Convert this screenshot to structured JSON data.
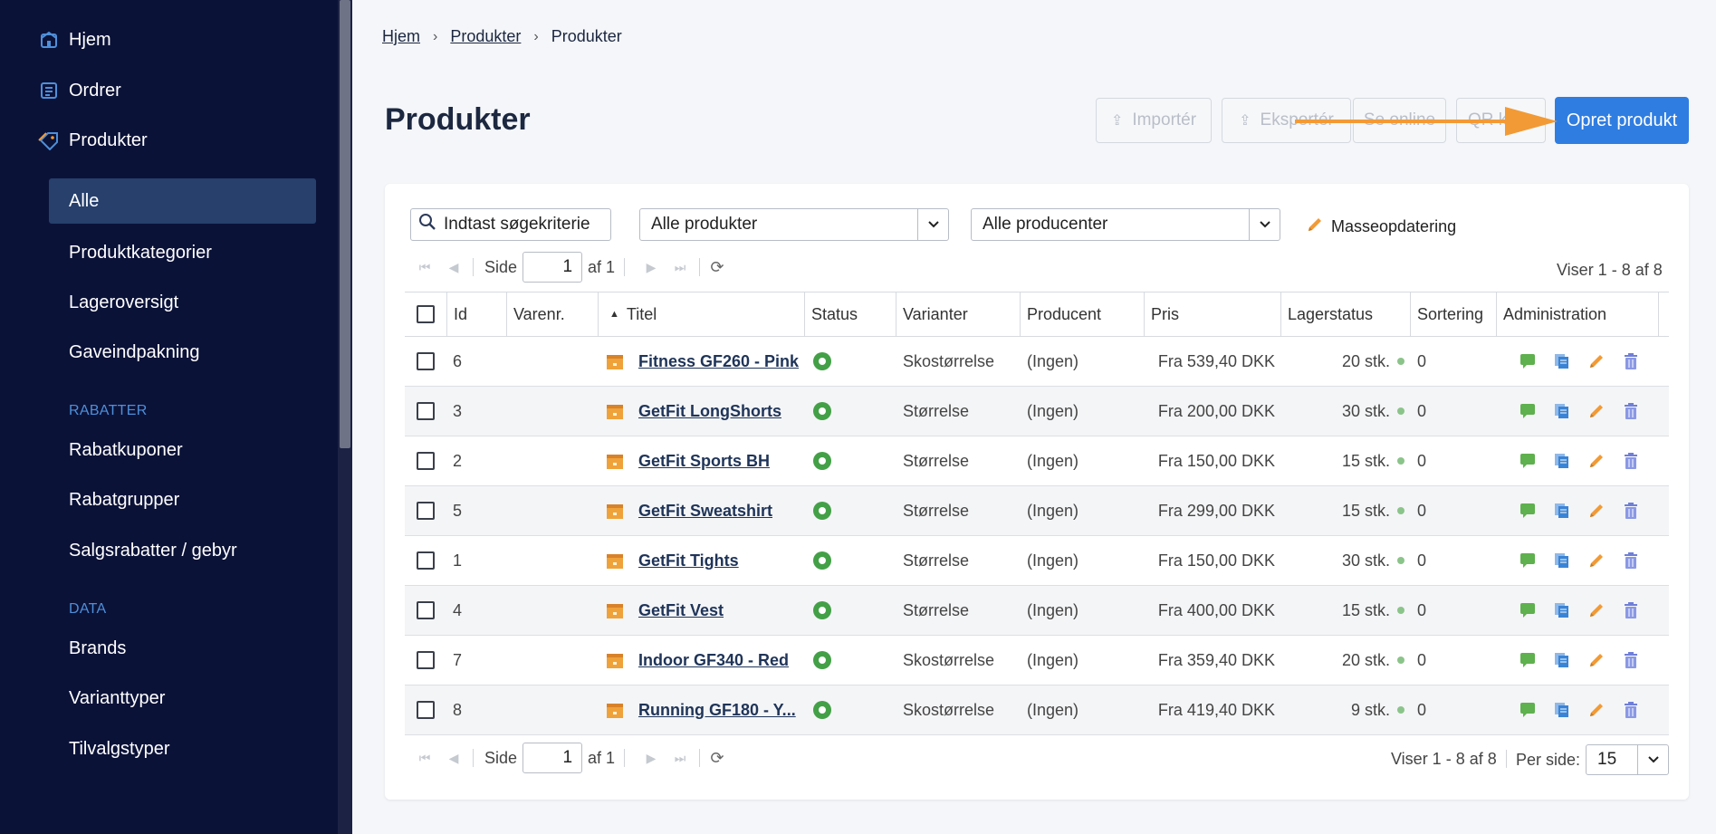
{
  "sidebar": {
    "main": [
      {
        "label": "Hjem",
        "icon": "home-icon"
      },
      {
        "label": "Ordrer",
        "icon": "orders-icon"
      },
      {
        "label": "Produkter",
        "icon": "tag-icon"
      }
    ],
    "product_sub": [
      "Alle",
      "Produktkategorier",
      "Lageroversigt",
      "Gaveindpakning"
    ],
    "sections": [
      {
        "title": "RABATTER",
        "items": [
          "Rabatkuponer",
          "Rabatgrupper",
          "Salgsrabatter / gebyr"
        ]
      },
      {
        "title": "DATA",
        "items": [
          "Brands",
          "Varianttyper",
          "Tilvalgstyper"
        ]
      }
    ]
  },
  "breadcrumb": [
    "Hjem",
    "Produkter",
    "Produkter"
  ],
  "page_title": "Produkter",
  "actions": {
    "import": "Importér",
    "export": "Eksportér",
    "online": "Se online",
    "qr": "QR k",
    "create": "Opret produkt"
  },
  "filters": {
    "search_placeholder": "Indtast søgekriterie",
    "products": "Alle produkter",
    "producers": "Alle producenter",
    "mass_update": "Masseopdatering"
  },
  "pager": {
    "side_label": "Side",
    "page": "1",
    "of": "af 1",
    "showing": "Viser 1 - 8 af 8",
    "per_side_label": "Per side:",
    "per_side": "15"
  },
  "columns": [
    "Id",
    "Varenr.",
    "Titel",
    "Status",
    "Varianter",
    "Producent",
    "Pris",
    "Lagerstatus",
    "Sortering",
    "Administration"
  ],
  "rows": [
    {
      "id": "6",
      "title": "Fitness GF260 - Pink",
      "variant": "Skostørrelse",
      "producer": "(Ingen)",
      "price": "Fra 539,40 DKK",
      "stock": "20 stk.",
      "sort": "0"
    },
    {
      "id": "3",
      "title": "GetFit LongShorts",
      "variant": "Størrelse",
      "producer": "(Ingen)",
      "price": "Fra 200,00 DKK",
      "stock": "30 stk.",
      "sort": "0"
    },
    {
      "id": "2",
      "title": "GetFit Sports BH",
      "variant": "Størrelse",
      "producer": "(Ingen)",
      "price": "Fra 150,00 DKK",
      "stock": "15 stk.",
      "sort": "0"
    },
    {
      "id": "5",
      "title": "GetFit Sweatshirt",
      "variant": "Størrelse",
      "producer": "(Ingen)",
      "price": "Fra 299,00 DKK",
      "stock": "15 stk.",
      "sort": "0"
    },
    {
      "id": "1",
      "title": "GetFit Tights",
      "variant": "Størrelse",
      "producer": "(Ingen)",
      "price": "Fra 150,00 DKK",
      "stock": "30 stk.",
      "sort": "0"
    },
    {
      "id": "4",
      "title": "GetFit Vest",
      "variant": "Størrelse",
      "producer": "(Ingen)",
      "price": "Fra 400,00 DKK",
      "stock": "15 stk.",
      "sort": "0"
    },
    {
      "id": "7",
      "title": "Indoor GF340 - Red",
      "variant": "Skostørrelse",
      "producer": "(Ingen)",
      "price": "Fra 359,40 DKK",
      "stock": "20 stk.",
      "sort": "0"
    },
    {
      "id": "8",
      "title": "Running GF180 - Y...",
      "variant": "Skostørrelse",
      "producer": "(Ingen)",
      "price": "Fra 419,40 DKK",
      "stock": "9 stk.",
      "sort": "0"
    }
  ],
  "colors": {
    "sidebar_bg": "#0b1238",
    "primary": "#2f7de1",
    "arrow": "#f29a35",
    "status_green": "#43a047"
  }
}
